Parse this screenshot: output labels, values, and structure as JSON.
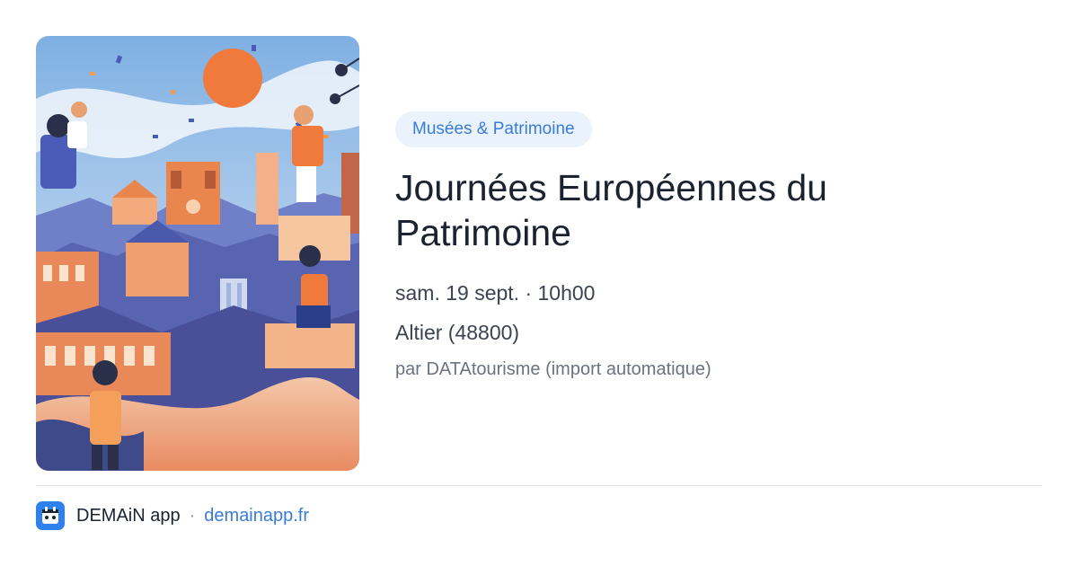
{
  "event": {
    "category": "Musées & Patrimoine",
    "title": "Journées Européennes du Patrimoine",
    "date_time": "sam. 19 sept. · 10h00",
    "location": "Altier (48800)",
    "source": "par DATAtourisme (import automatique)"
  },
  "image": {
    "icon": "illustrated-heritage-poster",
    "colors": {
      "sky": "#8fb8e3",
      "sun": "#f07a3c",
      "hills": "#5864b0",
      "buildings": "#e8864e"
    }
  },
  "footer": {
    "app_name": "DEMAiN app",
    "separator": "·",
    "url": "demainapp.fr",
    "logo_icon": "demain-app-logo-icon"
  },
  "colors": {
    "accent": "#3a7bd5",
    "badge_bg": "#eaf2fb",
    "title": "#1b2230",
    "muted": "#6b7280"
  }
}
